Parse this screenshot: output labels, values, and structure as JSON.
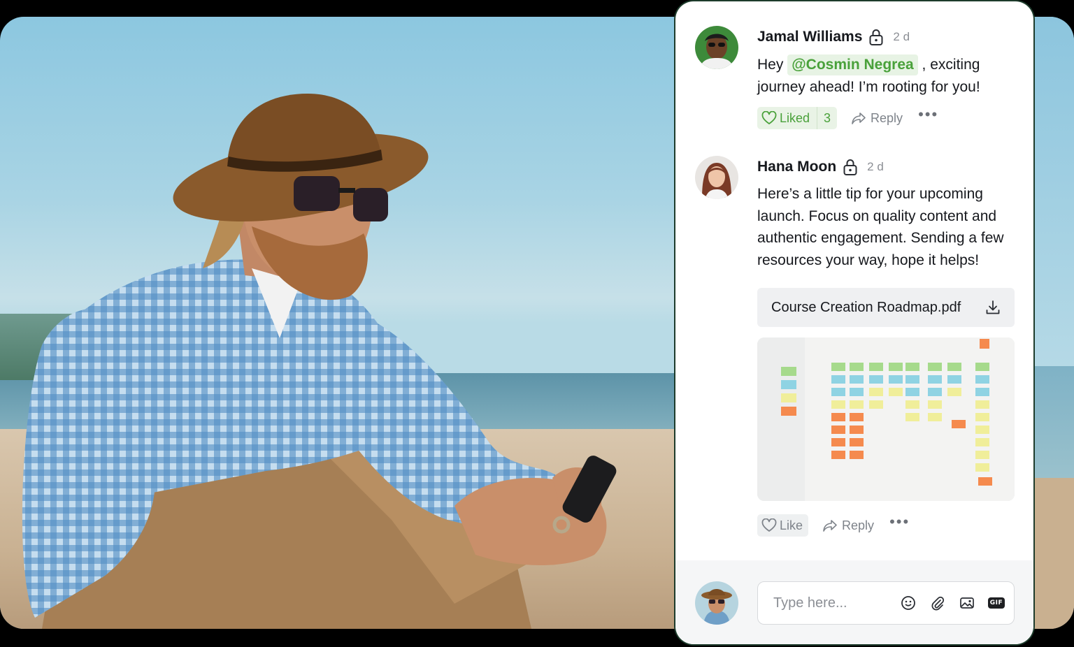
{
  "comments": [
    {
      "author": "Jamal Williams",
      "time": "2 d",
      "text_before": "Hey ",
      "mention": "@Cosmin Negrea",
      "text_after": " , exciting journey ahead! I’m rooting for you!",
      "like_label": "Liked",
      "like_count": "3",
      "reply_label": "Reply",
      "liked": true
    },
    {
      "author": "Hana Moon",
      "time": "2 d",
      "text": "Here’s a little tip for your upcoming launch. Focus on quality content and authentic engagement. Sending a few resources your way, hope it helps!",
      "attachment": "Course Creation Roadmap.pdf",
      "like_label": "Like",
      "reply_label": "Reply",
      "liked": false
    }
  ],
  "composer": {
    "placeholder": "Type here...",
    "gif_label": "GIF"
  },
  "colors": {
    "accent_green": "#49a13a",
    "mention_bg": "#e7f3e4",
    "card_border": "#1d3b2b"
  },
  "icons": [
    "lock-icon",
    "heart-icon",
    "reply-arrow-icon",
    "more-dots-icon",
    "download-icon",
    "emoji-icon",
    "attach-icon",
    "image-icon",
    "gif-icon"
  ]
}
